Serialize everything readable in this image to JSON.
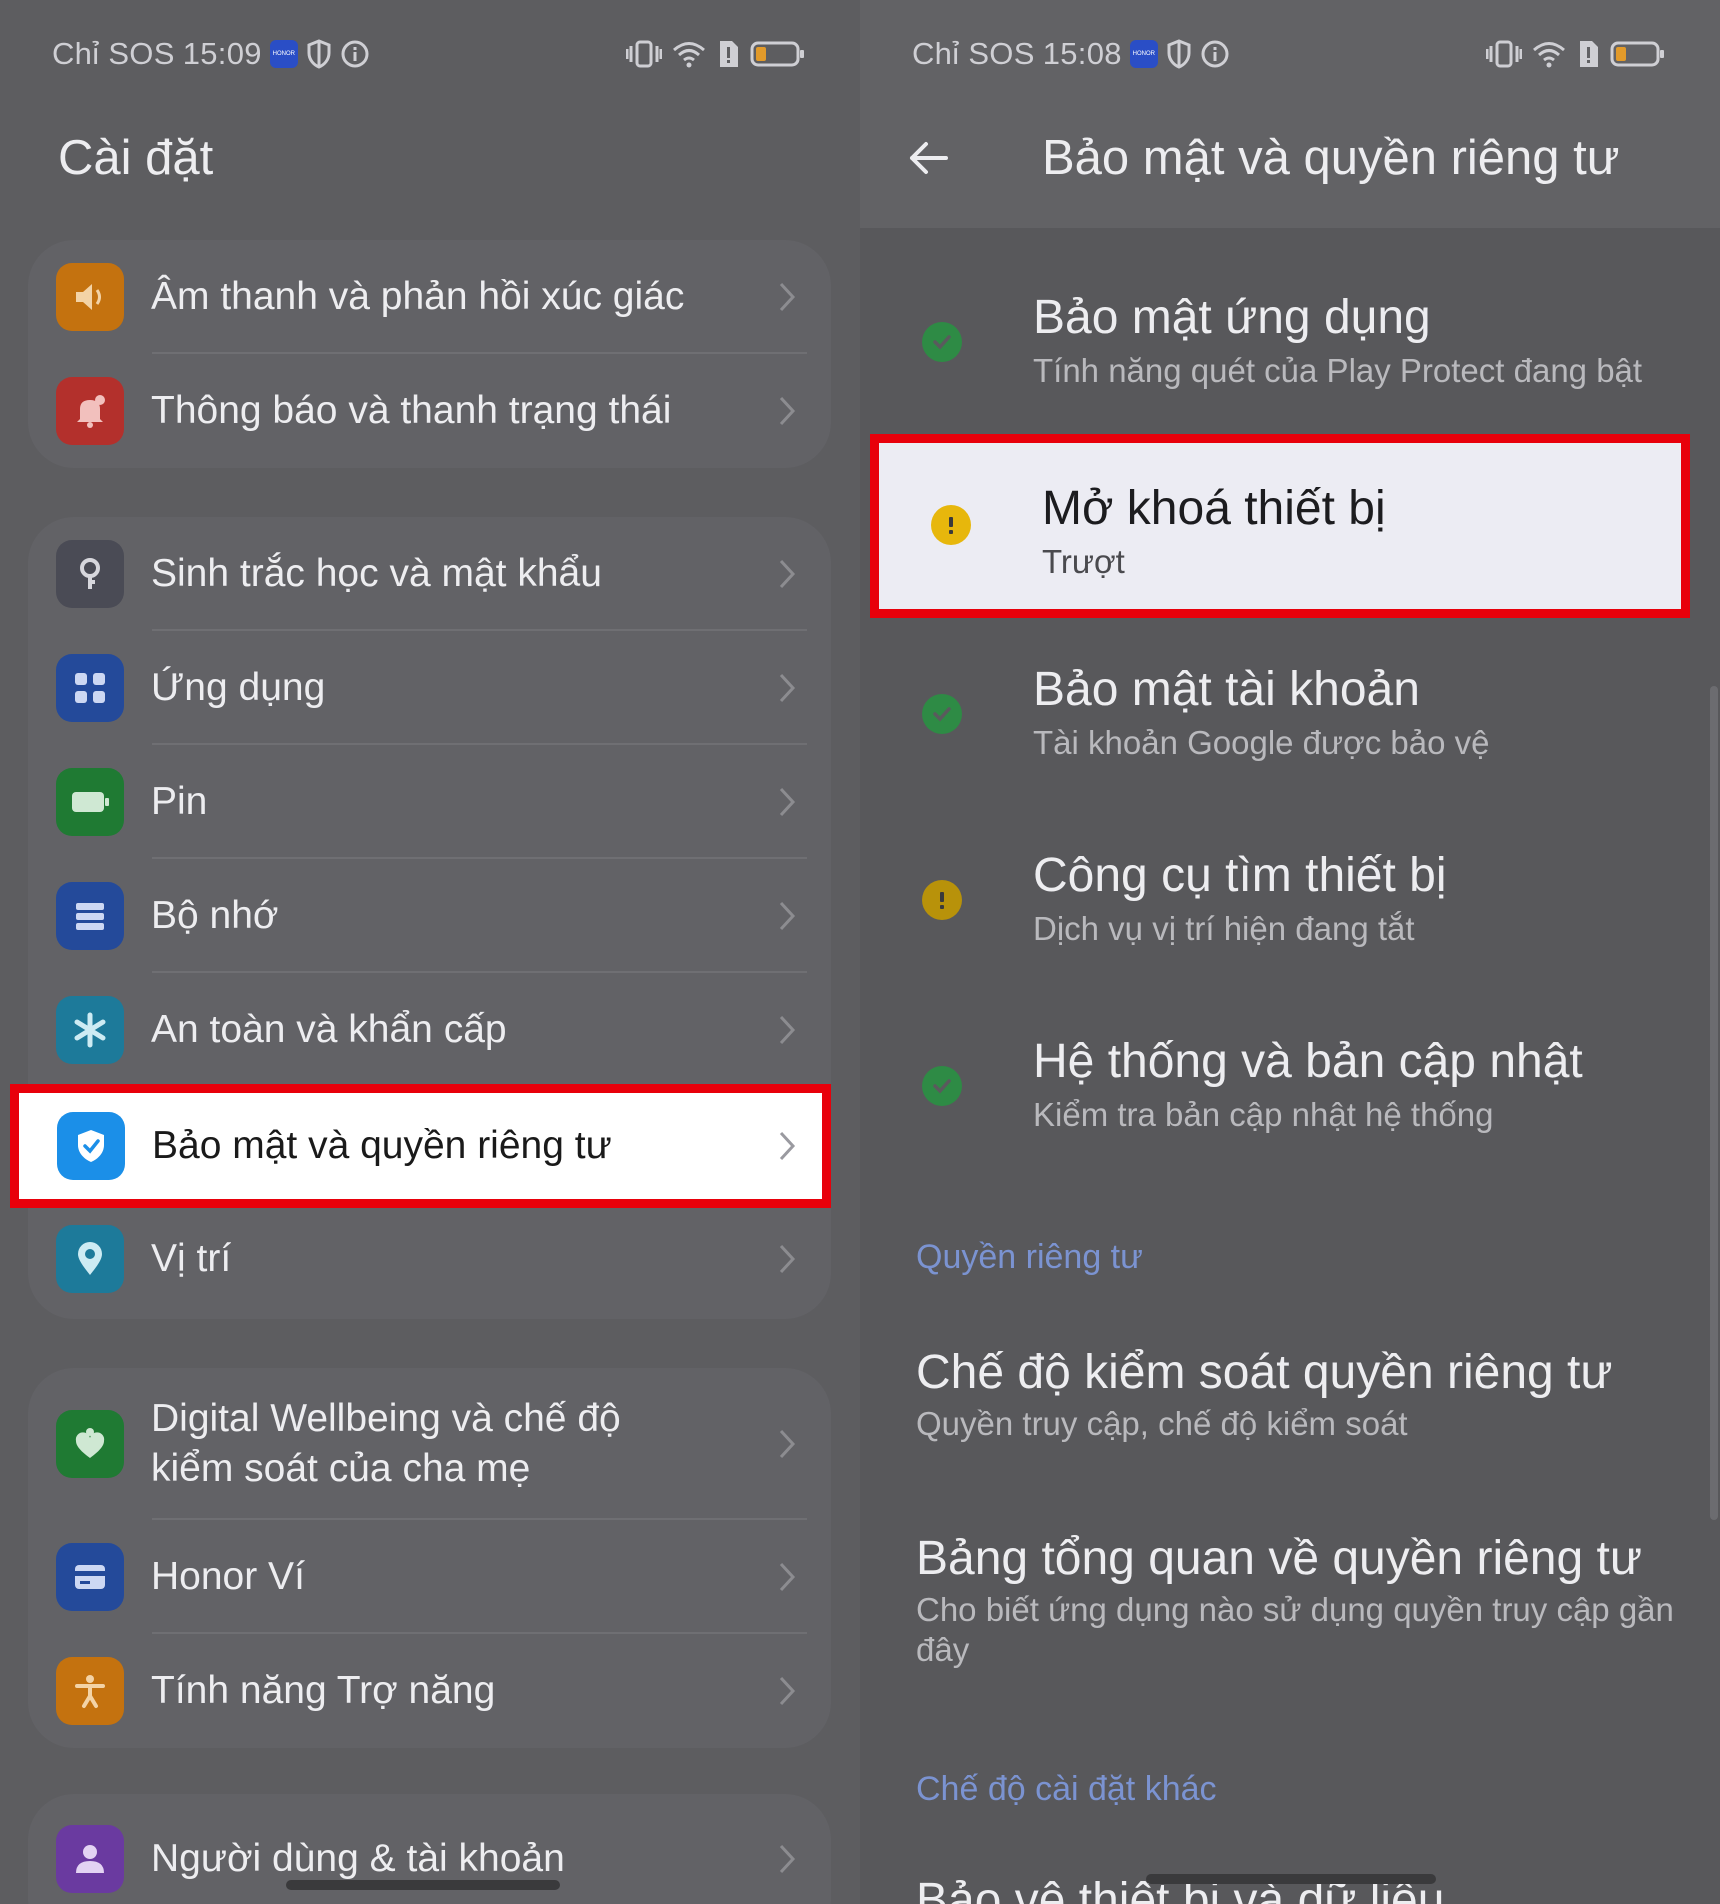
{
  "left": {
    "status": {
      "carrier": "Chỉ SOS",
      "time": "15:09",
      "badge": "HONOR"
    },
    "title": "Cài đặt",
    "groups": [
      {
        "items": [
          {
            "label": "Âm thanh và phản hồi xúc giác",
            "icon": "speaker-icon",
            "color": "#c4720f"
          },
          {
            "label": "Thông báo và thanh trạng thái",
            "icon": "bell-icon",
            "color": "#b3302c"
          }
        ]
      },
      {
        "items": [
          {
            "label": "Sinh trắc học và mật khẩu",
            "icon": "key-icon",
            "color": "#4a4b55"
          },
          {
            "label": "Ứng dụng",
            "icon": "apps-grid-icon",
            "color": "#244a9a"
          },
          {
            "label": "Pin",
            "icon": "battery-icon",
            "color": "#1f7a33"
          },
          {
            "label": "Bộ nhớ",
            "icon": "storage-icon",
            "color": "#244a9a"
          },
          {
            "label": "An toàn và khẩn cấp",
            "icon": "asterisk-icon",
            "color": "#1d7a9a"
          },
          {
            "label": "Bảo mật và quyền riêng tư",
            "icon": "shield-check-icon",
            "color": "#1b8fe8"
          },
          {
            "label": "Vị trí",
            "icon": "location-pin-icon",
            "color": "#1d7a9a"
          }
        ]
      },
      {
        "items": [
          {
            "label_line1": "Digital Wellbeing và chế độ",
            "label_line2": "kiểm soát của cha mẹ",
            "icon": "heart-person-icon",
            "color": "#1f7a33"
          },
          {
            "label": "Honor Ví",
            "icon": "wallet-icon",
            "color": "#244a9a"
          },
          {
            "label": "Tính năng Trợ năng",
            "icon": "accessibility-icon",
            "color": "#c4720f"
          }
        ]
      },
      {
        "items": [
          {
            "label": "Người dùng & tài khoản",
            "icon": "user-icon",
            "color": "#6a3aa0"
          }
        ]
      }
    ]
  },
  "right": {
    "status": {
      "carrier": "Chỉ SOS",
      "time": "15:08",
      "badge": "HONOR"
    },
    "title": "Bảo mật và quyền riêng tư",
    "security_items": [
      {
        "title": "Bảo mật ứng dụng",
        "subtitle": "Tính năng quét của Play Protect đang bật",
        "status": "ok"
      },
      {
        "title": "Mở khoá thiết bị",
        "subtitle": "Trượt",
        "status": "warning"
      },
      {
        "title": "Bảo mật tài khoản",
        "subtitle": "Tài khoản Google được bảo vệ",
        "status": "ok"
      },
      {
        "title": "Công cụ tìm thiết bị",
        "subtitle": "Dịch vụ vị trí hiện đang tắt",
        "status": "warning"
      },
      {
        "title": "Hệ thống và bản cập nhật",
        "subtitle": "Kiểm tra bản cập nhật hệ thống",
        "status": "ok"
      }
    ],
    "privacy_heading": "Quyền riêng tư",
    "privacy_items": [
      {
        "title": "Chế độ kiểm soát quyền riêng tư",
        "subtitle": "Quyền truy cập, chế độ kiểm soát"
      },
      {
        "title": "Bảng tổng quan về quyền riêng tư",
        "subtitle": "Cho biết ứng dụng nào sử dụng quyền truy cập gần đây"
      }
    ],
    "other_heading": "Chế độ cài đặt khác",
    "other_items": [
      {
        "title": "Bảo vệ thiết bị và dữ liệu"
      }
    ]
  },
  "colors": {
    "highlight_border": "#e8000b",
    "ok_green": "#2e8b45",
    "warning_yellow": "#e7b70c",
    "accent_blue": "#7b93d1"
  }
}
